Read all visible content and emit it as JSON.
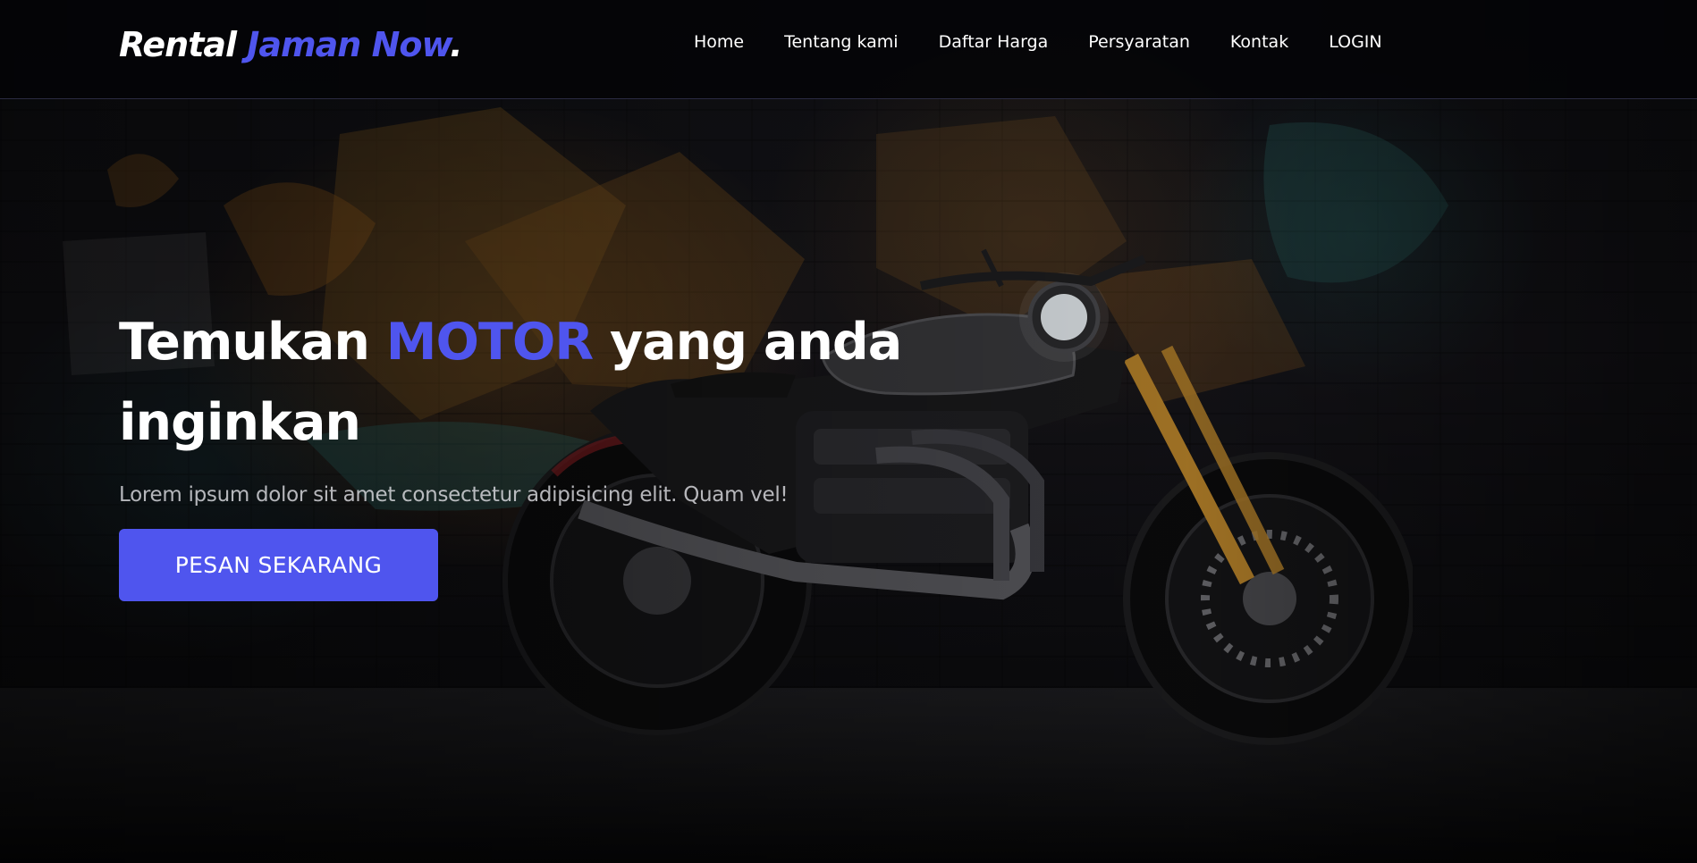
{
  "brand": {
    "name_part1": "Rental",
    "name_accent": "Jaman Now",
    "name_dot": "."
  },
  "nav": {
    "items": [
      {
        "label": "Home"
      },
      {
        "label": "Tentang kami"
      },
      {
        "label": "Daftar Harga"
      },
      {
        "label": "Persyaratan"
      },
      {
        "label": "Kontak"
      },
      {
        "label": "LOGIN"
      }
    ]
  },
  "hero": {
    "headline_part1": "Temukan",
    "headline_accent": "MOTOR",
    "headline_part2": "yang anda inginkan",
    "subtitle": "Lorem ipsum dolor sit amet consectetur adipisicing elit. Quam vel!",
    "cta_label": "PESAN SEKARANG",
    "background_image": "motorcycle-graffiti-wall-photo"
  },
  "colors": {
    "accent": "#4f55ee",
    "nav_background": "#050507",
    "text": "#ffffff"
  }
}
